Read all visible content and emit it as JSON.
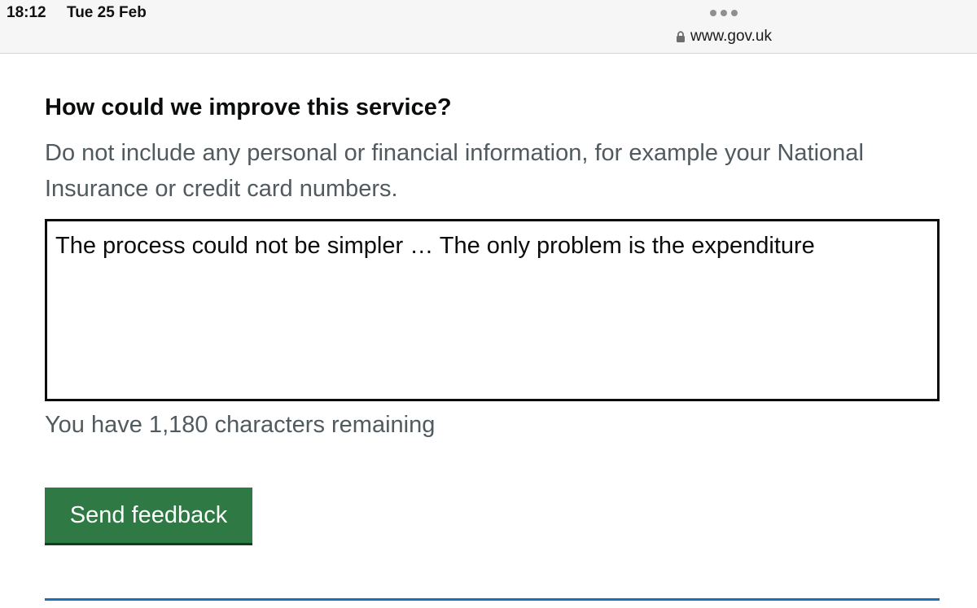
{
  "status_bar": {
    "time": "18:12",
    "date": "Tue 25 Feb"
  },
  "browser": {
    "url": "www.gov.uk",
    "lock_icon": "lock-icon",
    "menu_icon": "more-dots-icon"
  },
  "form": {
    "question": "How could we improve this service?",
    "hint": "Do not include any personal or financial information, for example your National Insurance or credit card numbers.",
    "textarea_value": "The process could not be simpler … The only problem is the expenditure",
    "char_count": "You have 1,180 characters remaining",
    "submit_label": "Send feedback"
  },
  "colors": {
    "button": "#2f7a44",
    "hint_text": "#505a5f",
    "rule": "#1d70b8"
  }
}
